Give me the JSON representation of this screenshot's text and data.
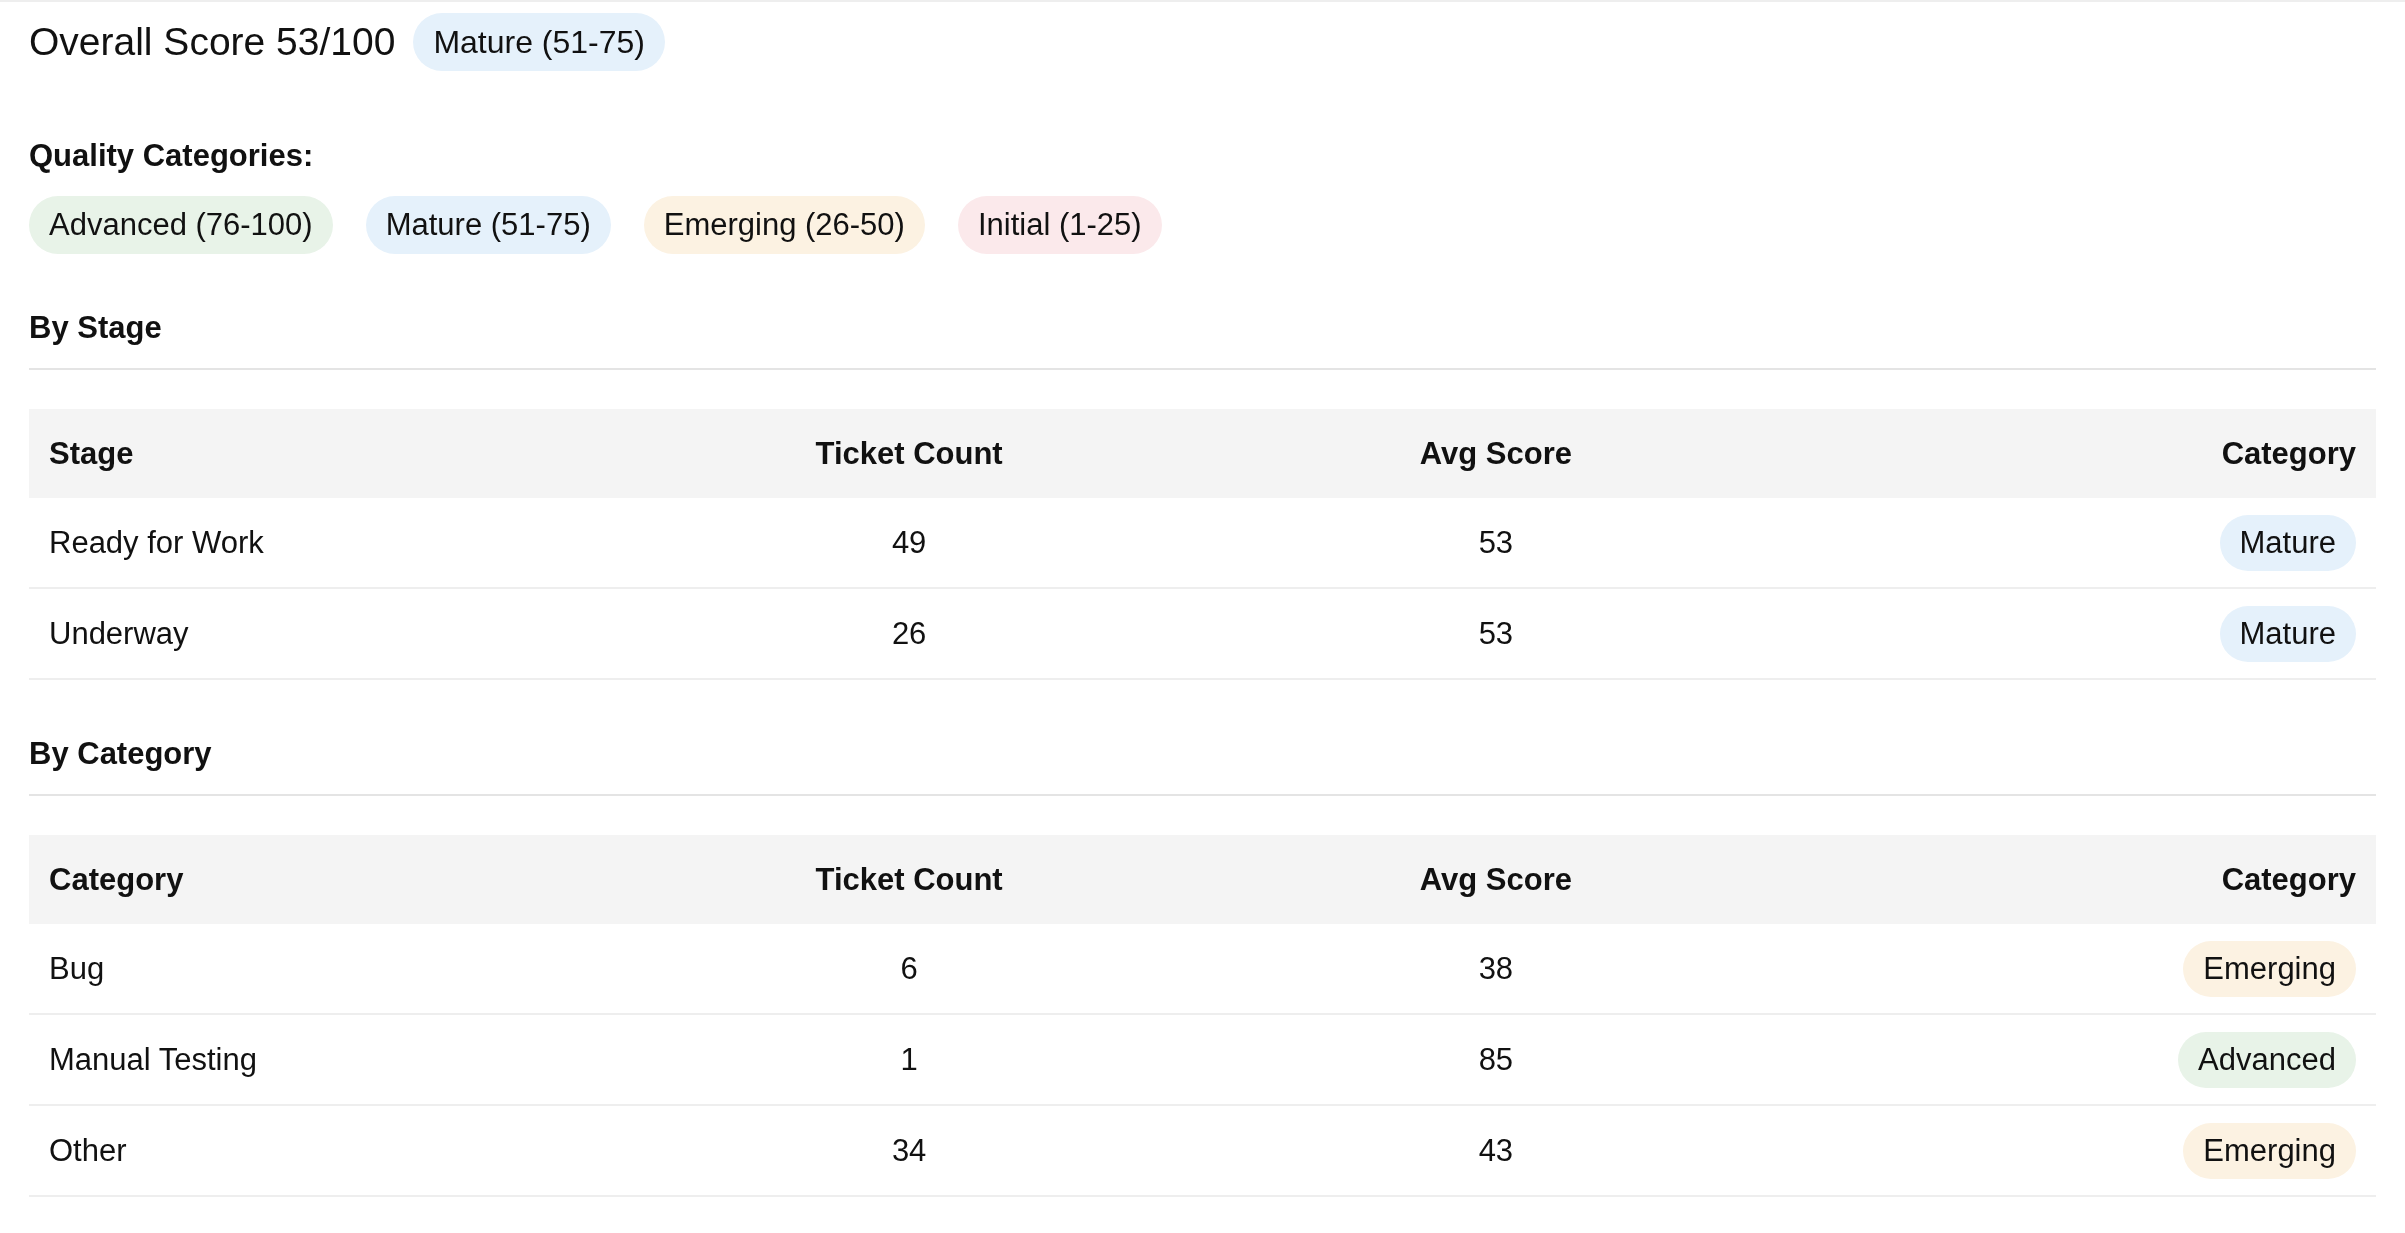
{
  "overall": {
    "title": "Overall Score 53/100",
    "badge": {
      "label": "Mature (51-75)",
      "color": "#e5f1fb"
    }
  },
  "legend": {
    "label": "Quality Categories:",
    "items": [
      {
        "label": "Advanced (76-100)",
        "color": "#e8f3e8"
      },
      {
        "label": "Mature (51-75)",
        "color": "#e5f1fb"
      },
      {
        "label": "Emerging (26-50)",
        "color": "#fcf2e2"
      },
      {
        "label": "Initial (1-25)",
        "color": "#fbe9eb"
      }
    ]
  },
  "sections": [
    {
      "title": "By Stage",
      "table": {
        "columns": [
          "Stage",
          "Ticket Count",
          "Avg Score",
          "Category"
        ],
        "rows": [
          {
            "cells": [
              "Ready for Work",
              "49",
              "53"
            ],
            "badge": {
              "label": "Mature",
              "color": "#e5f1fb"
            }
          },
          {
            "cells": [
              "Underway",
              "26",
              "53"
            ],
            "badge": {
              "label": "Mature",
              "color": "#e5f1fb"
            }
          }
        ]
      }
    },
    {
      "title": "By Category",
      "table": {
        "columns": [
          "Category",
          "Ticket Count",
          "Avg Score",
          "Category"
        ],
        "rows": [
          {
            "cells": [
              "Bug",
              "6",
              "38"
            ],
            "badge": {
              "label": "Emerging",
              "color": "#fcf2e2"
            }
          },
          {
            "cells": [
              "Manual Testing",
              "1",
              "85"
            ],
            "badge": {
              "label": "Advanced",
              "color": "#e8f3e8"
            }
          },
          {
            "cells": [
              "Other",
              "34",
              "43"
            ],
            "badge": {
              "label": "Emerging",
              "color": "#fcf2e2"
            }
          }
        ]
      }
    }
  ]
}
